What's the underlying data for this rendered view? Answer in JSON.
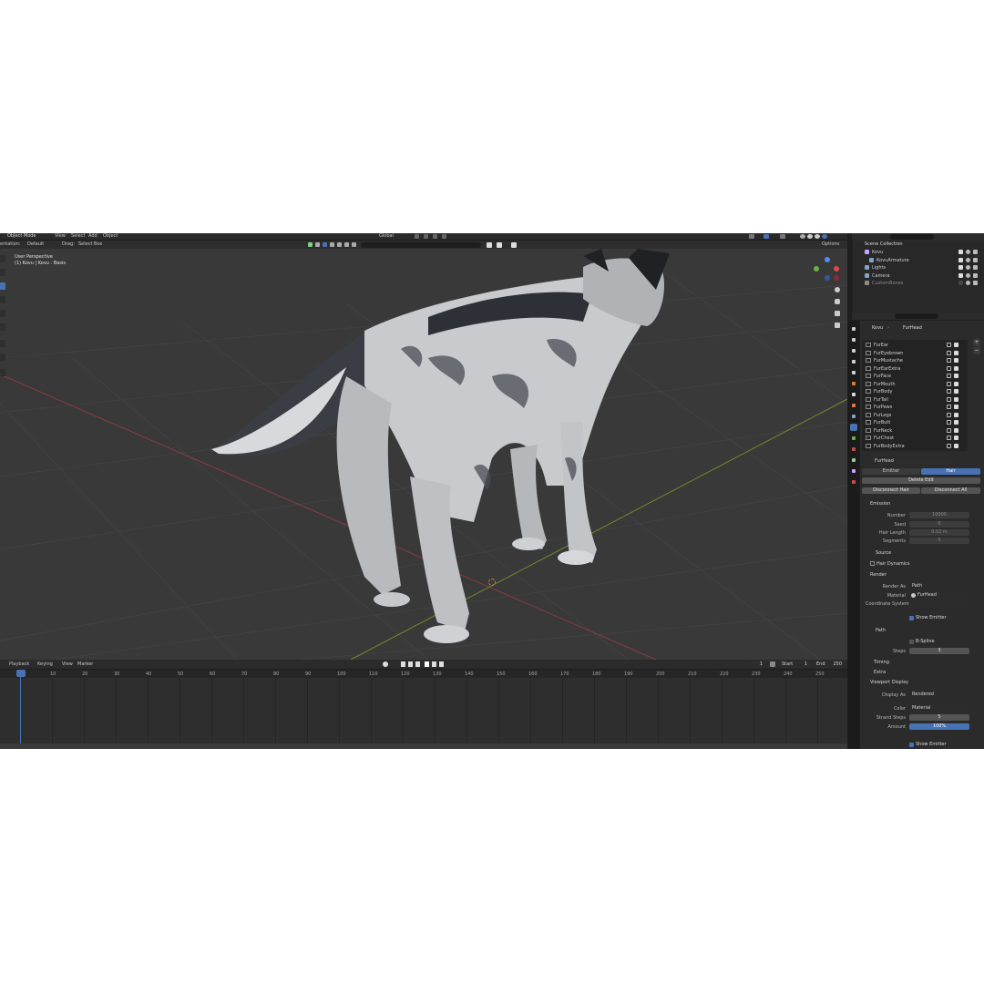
{
  "header": {
    "mode": "Object Mode",
    "menus": [
      "View",
      "Select",
      "Add",
      "Object"
    ],
    "orientation_label": "entation:",
    "orientation_value": "Default",
    "drag_label": "Drag:",
    "drag_value": "Select Box",
    "transform_orientation": "Global",
    "options": "Options"
  },
  "viewport": {
    "perspective": "User Perspective",
    "object_info": "(1) Kovu | Kovu : Basis"
  },
  "outliner": {
    "title": "Scene Collection",
    "items": [
      {
        "label": "Kovu",
        "color": "#c8a0ff"
      },
      {
        "label": "KovuArmature",
        "color": "#7fa4c7"
      },
      {
        "label": "Lights",
        "color": "#7fa4c7"
      },
      {
        "label": "Camera",
        "color": "#7fa4c7"
      },
      {
        "label": "CustomBones",
        "color": "#8a8a8a"
      }
    ]
  },
  "properties": {
    "breadcrumb_object": "Kovu",
    "breadcrumb_system": "FurHead",
    "particle_systems": [
      "FurEar",
      "FurEyebrown",
      "FurMustache",
      "FurEarExtra",
      "FurFace",
      "FurMouth",
      "FurBody",
      "FurTail",
      "FurPaws",
      "FurLegs",
      "FurButt",
      "FurNeck",
      "FurChest",
      "FurBodyExtra"
    ],
    "active_name": "FurHead",
    "type_tabs": [
      "Emitter",
      "Hair"
    ],
    "delete_edit": "Delete Edit",
    "disconnect_hair": "Disconnect Hair",
    "disconnect_all": "Disconnect All",
    "emission": {
      "header": "Emission",
      "number_label": "Number",
      "number_value": "10000",
      "seed_label": "Seed",
      "seed_value": "0",
      "hair_length_label": "Hair Length",
      "hair_length_value": "0.02 m",
      "segments_label": "Segments",
      "segments_value": "5"
    },
    "source": "Source",
    "hair_dynamics": "Hair Dynamics",
    "render": {
      "header": "Render",
      "render_as_label": "Render As",
      "render_as_value": "Path",
      "material_label": "Material",
      "material_value": "FurHead",
      "coord_label": "Coordinate System",
      "show_emitter": "Show Emitter",
      "path_header": "Path",
      "bspline": "B-Spline",
      "steps_label": "Steps",
      "steps_value": "3"
    },
    "timing": "Timing",
    "extra": "Extra",
    "viewport_display": {
      "header": "Viewport Display",
      "display_as_label": "Display As",
      "display_as_value": "Rendered",
      "color_label": "Color",
      "color_value": "Material",
      "strand_steps_label": "Strand Steps",
      "strand_steps_value": "5",
      "amount_label": "Amount",
      "amount_value": "100%",
      "show_emitter": "Show Emitter"
    }
  },
  "timeline": {
    "menus": [
      "Playback",
      "Keying",
      "View",
      "Marker"
    ],
    "current_frame": "1",
    "start_label": "Start",
    "start_value": "1",
    "end_label": "End",
    "end_value": "250",
    "ticks": [
      "1",
      "10",
      "20",
      "30",
      "40",
      "50",
      "60",
      "70",
      "80",
      "90",
      "100",
      "110",
      "120",
      "130",
      "140",
      "150",
      "160",
      "170",
      "180",
      "190",
      "200",
      "210",
      "220",
      "230",
      "240",
      "250"
    ]
  },
  "colors": {
    "accent": "#4772b3",
    "panel": "#2b2b2b",
    "viewport": "#393939"
  }
}
